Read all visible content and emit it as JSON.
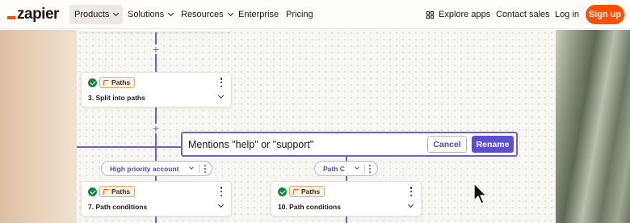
{
  "nav": {
    "logo": "zapier",
    "items": [
      {
        "label": "Products"
      },
      {
        "label": "Solutions"
      },
      {
        "label": "Resources"
      },
      {
        "label": "Enterprise"
      },
      {
        "label": "Pricing"
      }
    ],
    "explore_apps": "Explore apps",
    "contact_sales": "Contact sales",
    "login": "Log in",
    "signup": "Sign up"
  },
  "canvas": {
    "cards": [
      {
        "badge": "Paths",
        "title": "3. Split into paths"
      },
      {
        "badge": "Paths",
        "title": "7. Path conditions"
      },
      {
        "badge": "Paths",
        "title": "10. Path conditions"
      }
    ],
    "rename": {
      "value": "Mentions \"help\" or \"support\"",
      "cancel_label": "Cancel",
      "rename_label": "Rename"
    },
    "paths": [
      {
        "label": "High priority account"
      },
      {
        "label": "Path C"
      }
    ]
  },
  "colors": {
    "brand_orange": "#ff4f00",
    "accent_purple": "#5b4fd0",
    "connector": "#6e61c8",
    "success_green": "#138a3e"
  }
}
